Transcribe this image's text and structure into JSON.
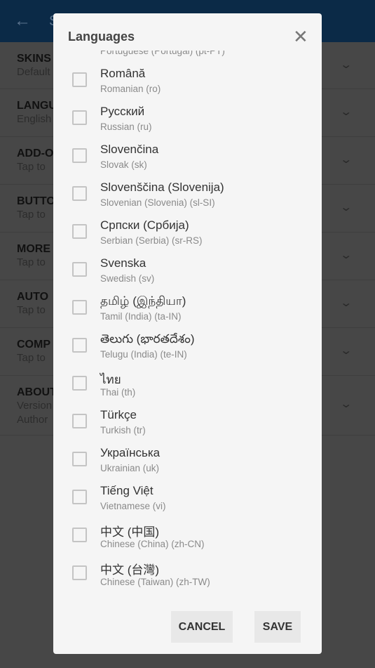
{
  "appbar": {
    "back_icon": "arrow-left-icon",
    "title": "S"
  },
  "sections": [
    {
      "title": "SKINS",
      "lines": [
        "Default"
      ]
    },
    {
      "title": "LANGU",
      "lines": [
        "English"
      ]
    },
    {
      "title": "ADD-O",
      "lines": [
        "Tap to"
      ]
    },
    {
      "title": "BUTTO",
      "lines": [
        "Tap to"
      ]
    },
    {
      "title": "MORE",
      "lines": [
        "Tap to"
      ]
    },
    {
      "title": "AUTO",
      "lines": [
        "Tap to"
      ]
    },
    {
      "title": "COMP",
      "lines": [
        "Tap to"
      ]
    },
    {
      "title": "ABOUT",
      "lines": [
        "Version",
        "Author"
      ]
    }
  ],
  "dialog": {
    "title": "Languages",
    "close_icon": "close-icon",
    "languages": [
      {
        "name": "",
        "english": "Portuguese (Portugal) (pt-PT)",
        "checked": false
      },
      {
        "name": "Română",
        "english": "Romanian (ro)",
        "checked": false
      },
      {
        "name": "Русский",
        "english": "Russian (ru)",
        "checked": false
      },
      {
        "name": "Slovenčina",
        "english": "Slovak (sk)",
        "checked": false
      },
      {
        "name": "Slovenščina (Slovenija)",
        "english": "Slovenian (Slovenia) (sl-SI)",
        "checked": false
      },
      {
        "name": "Српски (Србија)",
        "english": "Serbian (Serbia) (sr-RS)",
        "checked": false
      },
      {
        "name": "Svenska",
        "english": "Swedish (sv)",
        "checked": false
      },
      {
        "name": "தமிழ் (இந்தியா)",
        "english": "Tamil (India) (ta-IN)",
        "checked": false
      },
      {
        "name": "తెలుగు (భారతదేశం)",
        "english": "Telugu (India) (te-IN)",
        "checked": false
      },
      {
        "name": "ไทย",
        "english": "Thai (th)",
        "checked": false
      },
      {
        "name": "Türkçe",
        "english": "Turkish (tr)",
        "checked": false
      },
      {
        "name": "Українська",
        "english": "Ukrainian (uk)",
        "checked": false
      },
      {
        "name": "Tiếng Việt",
        "english": "Vietnamese (vi)",
        "checked": false
      },
      {
        "name": "中文 (中国)",
        "english": "Chinese (China) (zh-CN)",
        "checked": false
      },
      {
        "name": "中文 (台灣)",
        "english": "Chinese (Taiwan) (zh-TW)",
        "checked": false
      }
    ],
    "cancel_label": "CANCEL",
    "save_label": "SAVE"
  }
}
